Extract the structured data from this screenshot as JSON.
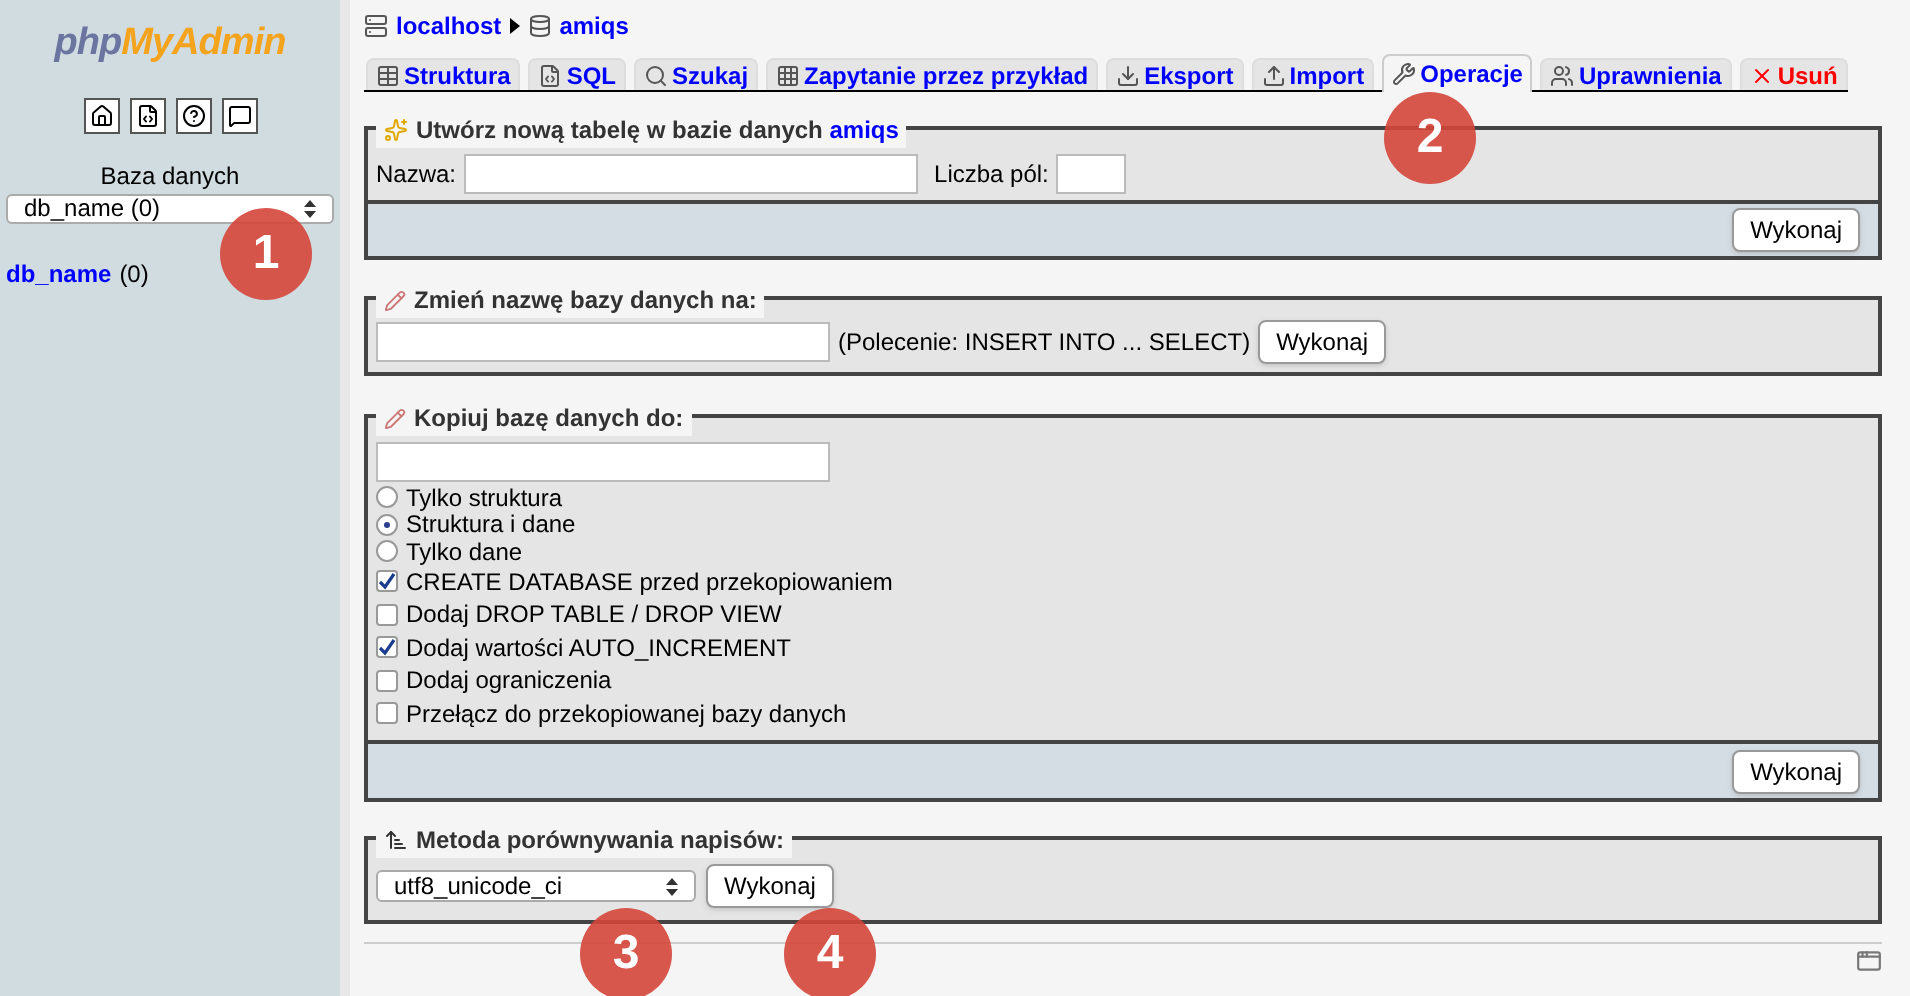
{
  "sidebar": {
    "logo": [
      "php",
      "MyAdmin"
    ],
    "db_label": "Baza danych",
    "db_select": "db_name (0)",
    "db_link": "db_name",
    "db_count": "(0)"
  },
  "breadcrumb": [
    "localhost",
    "amiqs"
  ],
  "tabs": [
    {
      "label": "Struktura",
      "selected": false,
      "danger": false
    },
    {
      "label": "SQL",
      "selected": false,
      "danger": false
    },
    {
      "label": "Szukaj",
      "selected": false,
      "danger": false
    },
    {
      "label": "Zapytanie przez przykład",
      "selected": false,
      "danger": false
    },
    {
      "label": "Eksport",
      "selected": false,
      "danger": false
    },
    {
      "label": "Import",
      "selected": false,
      "danger": false
    },
    {
      "label": "Operacje",
      "selected": true,
      "danger": false
    },
    {
      "label": "Uprawnienia",
      "selected": false,
      "danger": false
    },
    {
      "label": "Usuń",
      "selected": false,
      "danger": true
    }
  ],
  "create_table": {
    "legend": "Utwórz nową tabelę w bazie danych",
    "db": "amiqs",
    "name_label": "Nazwa:",
    "fields_label": "Liczba pól:",
    "button": "Wykonaj"
  },
  "rename": {
    "legend": "Zmień nazwę bazy danych na:",
    "note": "(Polecenie: INSERT INTO ... SELECT)",
    "button": "Wykonaj"
  },
  "copy": {
    "legend": "Kopiuj bazę danych do:",
    "options": [
      {
        "kind": "radio",
        "label": "Tylko struktura",
        "selected": false
      },
      {
        "kind": "radio",
        "label": "Struktura i dane",
        "selected": true
      },
      {
        "kind": "radio",
        "label": "Tylko dane",
        "selected": false
      },
      {
        "kind": "checkbox",
        "label": "CREATE DATABASE przed przekopiowaniem",
        "checked": true
      },
      {
        "kind": "checkbox",
        "label": "Dodaj DROP TABLE / DROP VIEW",
        "checked": false
      },
      {
        "kind": "checkbox",
        "label": "Dodaj wartości AUTO_INCREMENT",
        "checked": true
      },
      {
        "kind": "checkbox",
        "label": "Dodaj ograniczenia",
        "checked": false
      },
      {
        "kind": "checkbox",
        "label": "Przełącz do przekopiowanej bazy danych",
        "checked": false
      }
    ],
    "button": "Wykonaj"
  },
  "collation": {
    "legend": "Metoda porównywania napisów:",
    "select": "utf8_unicode_ci",
    "button": "Wykonaj"
  },
  "annotations": [
    "1",
    "2",
    "3",
    "4"
  ]
}
